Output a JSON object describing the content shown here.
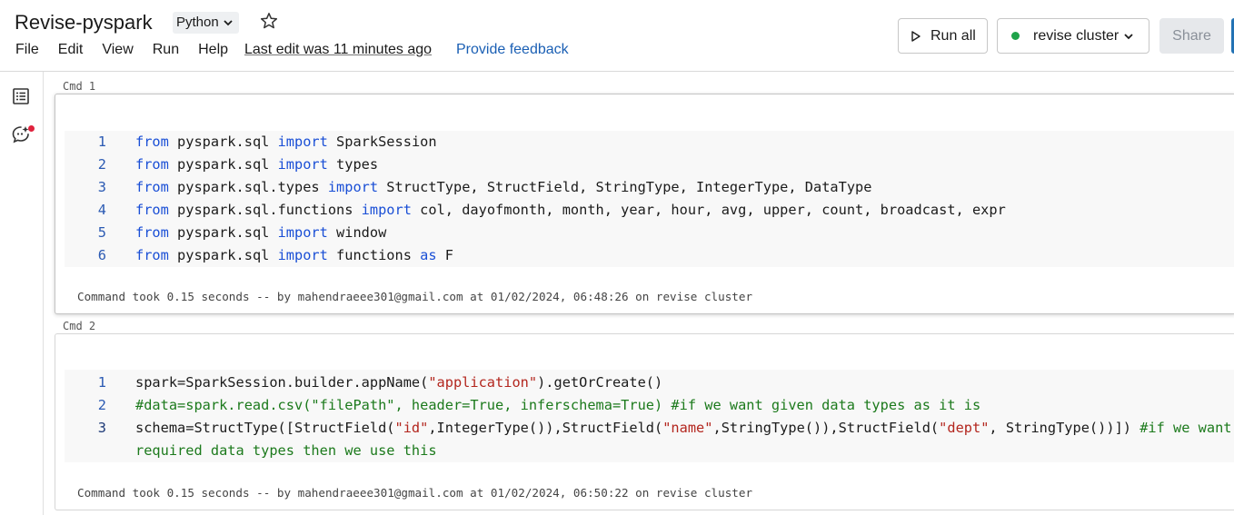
{
  "notebook": {
    "title": "Revise-pyspark",
    "language": "Python",
    "last_edit": "Last edit was 11 minutes ago",
    "feedback": "Provide feedback"
  },
  "menu": [
    "File",
    "Edit",
    "View",
    "Run",
    "Help"
  ],
  "toolbar": {
    "run_all": "Run all",
    "cluster": "revise cluster",
    "cluster_status_color": "#1fa34a",
    "share": "Share"
  },
  "rail": {
    "icons": [
      "table-of-contents-icon",
      "assistant-chat-icon"
    ],
    "notification_color": "#e0223d"
  },
  "cells": [
    {
      "label": "Cmd 1",
      "lines": [
        {
          "n": "1",
          "tokens": [
            [
              "kw",
              "from"
            ],
            [
              "t",
              " pyspark.sql "
            ],
            [
              "kw",
              "import"
            ],
            [
              "t",
              " SparkSession"
            ]
          ]
        },
        {
          "n": "2",
          "tokens": [
            [
              "kw",
              "from"
            ],
            [
              "t",
              " pyspark.sql "
            ],
            [
              "kw",
              "import"
            ],
            [
              "t",
              " types"
            ]
          ]
        },
        {
          "n": "3",
          "tokens": [
            [
              "kw",
              "from"
            ],
            [
              "t",
              " pyspark.sql.types "
            ],
            [
              "kw",
              "import"
            ],
            [
              "t",
              " StructType, StructField, StringType, IntegerType, DataType"
            ]
          ]
        },
        {
          "n": "4",
          "tokens": [
            [
              "kw",
              "from"
            ],
            [
              "t",
              " pyspark.sql.functions "
            ],
            [
              "kw",
              "import"
            ],
            [
              "t",
              " col, dayofmonth, month, year, hour, avg, upper, count, broadcast, expr"
            ]
          ]
        },
        {
          "n": "5",
          "tokens": [
            [
              "kw",
              "from"
            ],
            [
              "t",
              " pyspark.sql "
            ],
            [
              "kw",
              "import"
            ],
            [
              "t",
              " window"
            ]
          ]
        },
        {
          "n": "6",
          "tokens": [
            [
              "kw",
              "from"
            ],
            [
              "t",
              " pyspark.sql "
            ],
            [
              "kw",
              "import"
            ],
            [
              "t",
              " functions "
            ],
            [
              "kw",
              "as"
            ],
            [
              "t",
              " F"
            ]
          ]
        }
      ],
      "status": "Command took 0.15 seconds -- by mahendraeee301@gmail.com at 01/02/2024, 06:48:26 on revise cluster"
    },
    {
      "label": "Cmd 2",
      "lines": [
        {
          "n": "1",
          "tokens": [
            [
              "t",
              "spark=SparkSession.builder.appName("
            ],
            [
              "str",
              "\"application\""
            ],
            [
              "t",
              ").getOrCreate()"
            ]
          ]
        },
        {
          "n": "2",
          "tokens": [
            [
              "cm",
              "#data=spark.read.csv(\"filePath\", header=True, inferschema=True) #if we want given data types as it is"
            ]
          ]
        },
        {
          "n": "3",
          "tokens": [
            [
              "t",
              "schema=StructType([StructField("
            ],
            [
              "str",
              "\"id\""
            ],
            [
              "t",
              ",IntegerType()),StructField("
            ],
            [
              "str",
              "\"name\""
            ],
            [
              "t",
              ",StringType()),StructField("
            ],
            [
              "str",
              "\"dept\""
            ],
            [
              "t",
              ", StringType())]) "
            ],
            [
              "cm",
              "#if we want our"
            ]
          ]
        },
        {
          "n": "",
          "tokens": [
            [
              "cm",
              "required data types then we use this"
            ]
          ]
        }
      ],
      "status": "Command took 0.15 seconds -- by mahendraeee301@gmail.com at 01/02/2024, 06:50:22 on revise cluster"
    }
  ]
}
